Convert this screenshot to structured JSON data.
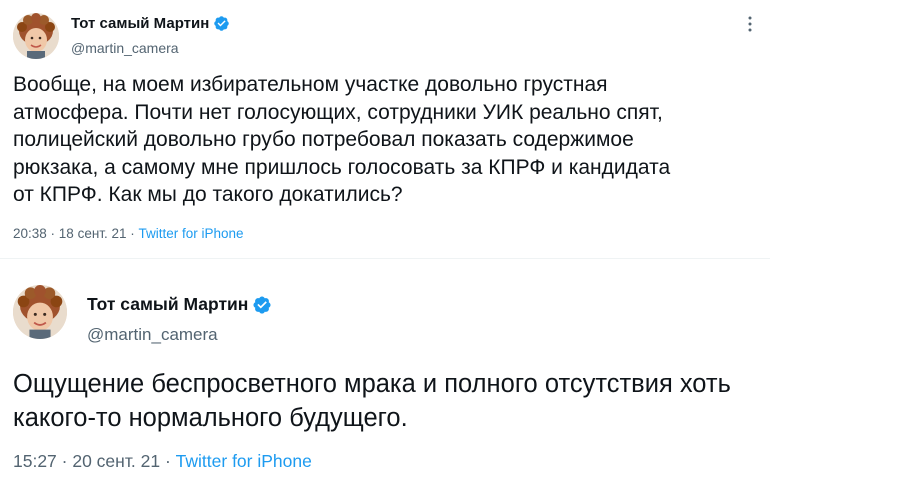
{
  "colors": {
    "verified_blue": "#1d9bf0",
    "secondary_text": "#536471",
    "primary_text": "#0f1419"
  },
  "tweets": [
    {
      "display_name": "Тот самый Мартин",
      "verified_icon": "verified-badge-icon",
      "handle": "@martin_camera",
      "text": "Вообще, на моем избирательном участке довольно грустная\nатмосфера. Почти нет голосующих, сотрудники УИК реально спят,\nполицейский довольно грубо потребовал показать содержимое\nрюкзака, а самому мне пришлось голосовать за КПРФ и кандидата\nот КПРФ. Как мы до такого докатились?",
      "time": "20:38",
      "date": "18 сент. 21",
      "separator": " · ",
      "source": "Twitter for iPhone",
      "more_icon": "more-options-icon"
    },
    {
      "display_name": "Тот самый Мартин",
      "verified_icon": "verified-badge-icon",
      "handle": "@martin_camera",
      "text": "Ощущение беспросветного мрака и полного отсутствия хоть\nкакого-то нормального будущего.",
      "time": "15:27",
      "date": "20 сент. 21",
      "separator": " · ",
      "source": "Twitter for iPhone"
    }
  ]
}
